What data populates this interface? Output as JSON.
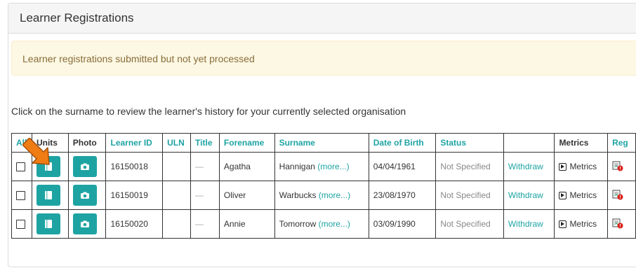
{
  "panel": {
    "title": "Learner Registrations"
  },
  "alert": {
    "text": "Learner registrations submitted but not yet processed"
  },
  "instruction": "Click on the surname to review the learner's history for your currently selected organisation",
  "table": {
    "headers": {
      "all": "All",
      "units": "Units",
      "photo": "Photo",
      "learner_id": "Learner ID",
      "uln": "ULN",
      "title": "Title",
      "forename": "Forename",
      "surname": "Surname",
      "dob": "Date of Birth",
      "status": "Status",
      "withdraw": "",
      "metrics": "Metrics",
      "reg": "Reg"
    },
    "more_label": "(more...)",
    "withdraw_label": "Withdraw",
    "metrics_label": "Metrics",
    "title_placeholder": "—",
    "rows": [
      {
        "learner_id": "16150018",
        "uln": "",
        "forename": "Agatha",
        "surname": "Hannigan",
        "dob": "04/04/1961",
        "status": "Not Specified"
      },
      {
        "learner_id": "16150019",
        "uln": "",
        "forename": "Oliver",
        "surname": "Warbucks",
        "dob": "23/08/1970",
        "status": "Not Specified"
      },
      {
        "learner_id": "16150020",
        "uln": "",
        "forename": "Annie",
        "surname": "Tomorrow",
        "dob": "03/09/1990",
        "status": "Not Specified"
      }
    ]
  },
  "colors": {
    "accent": "#1ea3a3",
    "alert_bg": "#fcf8e3",
    "alert_text": "#8a6d3b",
    "arrow": "#f07c14"
  }
}
